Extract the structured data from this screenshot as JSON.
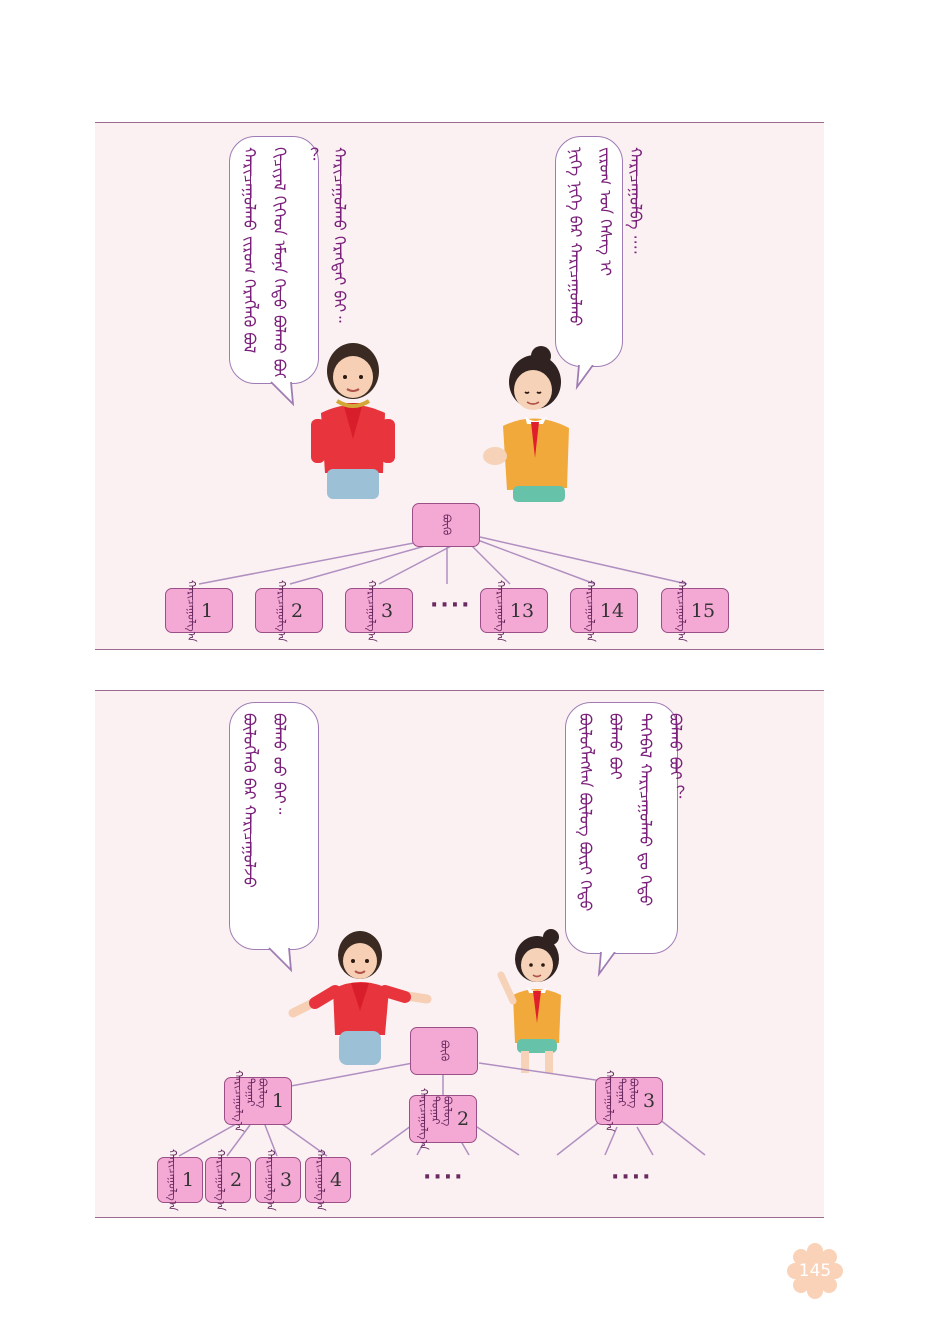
{
  "page_number": "145",
  "panel1": {
    "bubble_left": {
      "lines": [
        "ᠬᠠᠷᠢᠴᠠᠭᠤᠯᠬᠤ ᠵᠢᠷᠤᠭ ᠬᠡᠷᠡᠭᠯᠡᠬᠦ ᠪᠣᠯ ᠬᠢᠴᠢᠶᠡᠯ ᠬᠢᠬᠡᠳ ᠡᠮᠦᠨᠡ ᠬᠡᠳᠦ ᠪᠣᠯᠬᠤ ᠪᠤᠢ ︖",
        "ᠬᠠᠷᠢᠴᠠᠭᠤᠯᠬᠤ ᠬᠡᠷᠡᠭᠲᠡᠢ ᠪᠠᠢ᠃"
      ]
    },
    "bubble_right": {
      "lines": [
        "ᠨᠢᠭᠡ ᠨᠢᠭᠡ ᠪᠠᠷ ᠬᠠᠷᠢᠴᠠᠭᠤᠯᠬᠤ ᠵᠢᠷᠤᠭ ᠤᠨ ᠬᠡᠰᠡᠭ ᠢ",
        "ᠬᠠᠷᠢᠴᠠᠭᠤᠯᠪᠠ ····"
      ]
    },
    "root_label": "ᠪᠦᠬᠦ",
    "box_label": "ᠬᠠᠷᠢᠴᠠᠭᠤᠯᠭ᠎ᠠ",
    "leaves": [
      "1",
      "2",
      "3",
      "13",
      "14",
      "15"
    ],
    "dots": "····"
  },
  "panel2": {
    "bubble_left": {
      "lines": [
        "ᠪᠦᠯᠦᠭᠯᠡᠬᠦ ᠪᠠᠷ ᠬᠠᠷᠢᠴᠠᠭᠤᠯᠵᠤ",
        "ᠪᠣᠯᠬᠤ ᠦᠦ ᠪᠠᠢ᠃"
      ]
    },
    "bubble_right": {
      "lines": [
        "ᠪᠦᠯᠦᠭᠯᠡᠭᠰᠡᠨ ᠪᠦᠯᠦᠭ ᠪᠦᠷᠢ ᠬᠡᠳᠦ ᠪᠣᠯᠬᠤ ᠪᠤᠢ",
        "ᠲᠡᠭᠡᠪᠡᠯ ᠬᠠᠷᠢᠴᠠᠭᠤᠯᠬᠤ ᠳᠤ ᠬᠡᠳᠦ",
        "ᠪᠣᠯᠬᠤ ᠪᠤᠢ ︖"
      ]
    },
    "root_label": "ᠪᠦᠬᠦ",
    "group_label": "ᠳᠤᠭᠠᠷ ᠪᠦᠯᠦᠭ",
    "box_label": "ᠬᠠᠷᠢᠴᠠᠭᠤᠯᠭ᠎ᠠ",
    "groups": [
      "1",
      "2",
      "3"
    ],
    "leaves": [
      "1",
      "2",
      "3",
      "4"
    ],
    "dots_a": "····",
    "dots_b": "····"
  },
  "colors": {
    "box_fill": "#f4a9d5",
    "box_border": "#9a4f86",
    "panel_bg": "#fbf1f3",
    "bubble_border": "#a07cb4",
    "text_purple": "#7a1f7a"
  }
}
